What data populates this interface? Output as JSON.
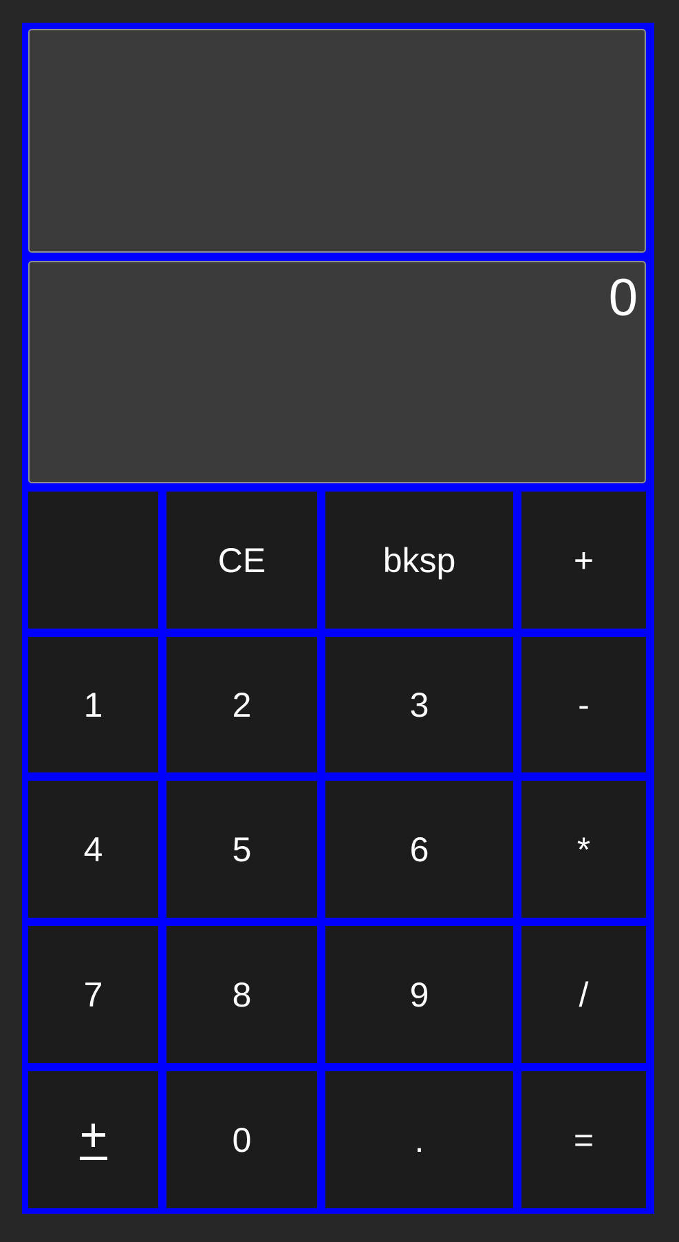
{
  "display": {
    "history": "",
    "value": "0"
  },
  "keys": [
    {
      "id": "blank",
      "label": ""
    },
    {
      "id": "ce",
      "label": "CE"
    },
    {
      "id": "bksp",
      "label": "bksp"
    },
    {
      "id": "plus",
      "label": "+"
    },
    {
      "id": "1",
      "label": "1"
    },
    {
      "id": "2",
      "label": "2"
    },
    {
      "id": "3",
      "label": "3"
    },
    {
      "id": "minus",
      "label": "-"
    },
    {
      "id": "4",
      "label": "4"
    },
    {
      "id": "5",
      "label": "5"
    },
    {
      "id": "6",
      "label": "6"
    },
    {
      "id": "multiply",
      "label": "*"
    },
    {
      "id": "7",
      "label": "7"
    },
    {
      "id": "8",
      "label": "8"
    },
    {
      "id": "9",
      "label": "9"
    },
    {
      "id": "divide",
      "label": "/"
    },
    {
      "id": "plusminus",
      "label": "±"
    },
    {
      "id": "0",
      "label": "0"
    },
    {
      "id": "decimal",
      "label": "."
    },
    {
      "id": "equals",
      "label": "="
    }
  ],
  "colors": {
    "background": "#272727",
    "frame": "#0000ff",
    "display": "#3c3b3c",
    "key": "#1c1c1c",
    "text": "#ffffff"
  }
}
